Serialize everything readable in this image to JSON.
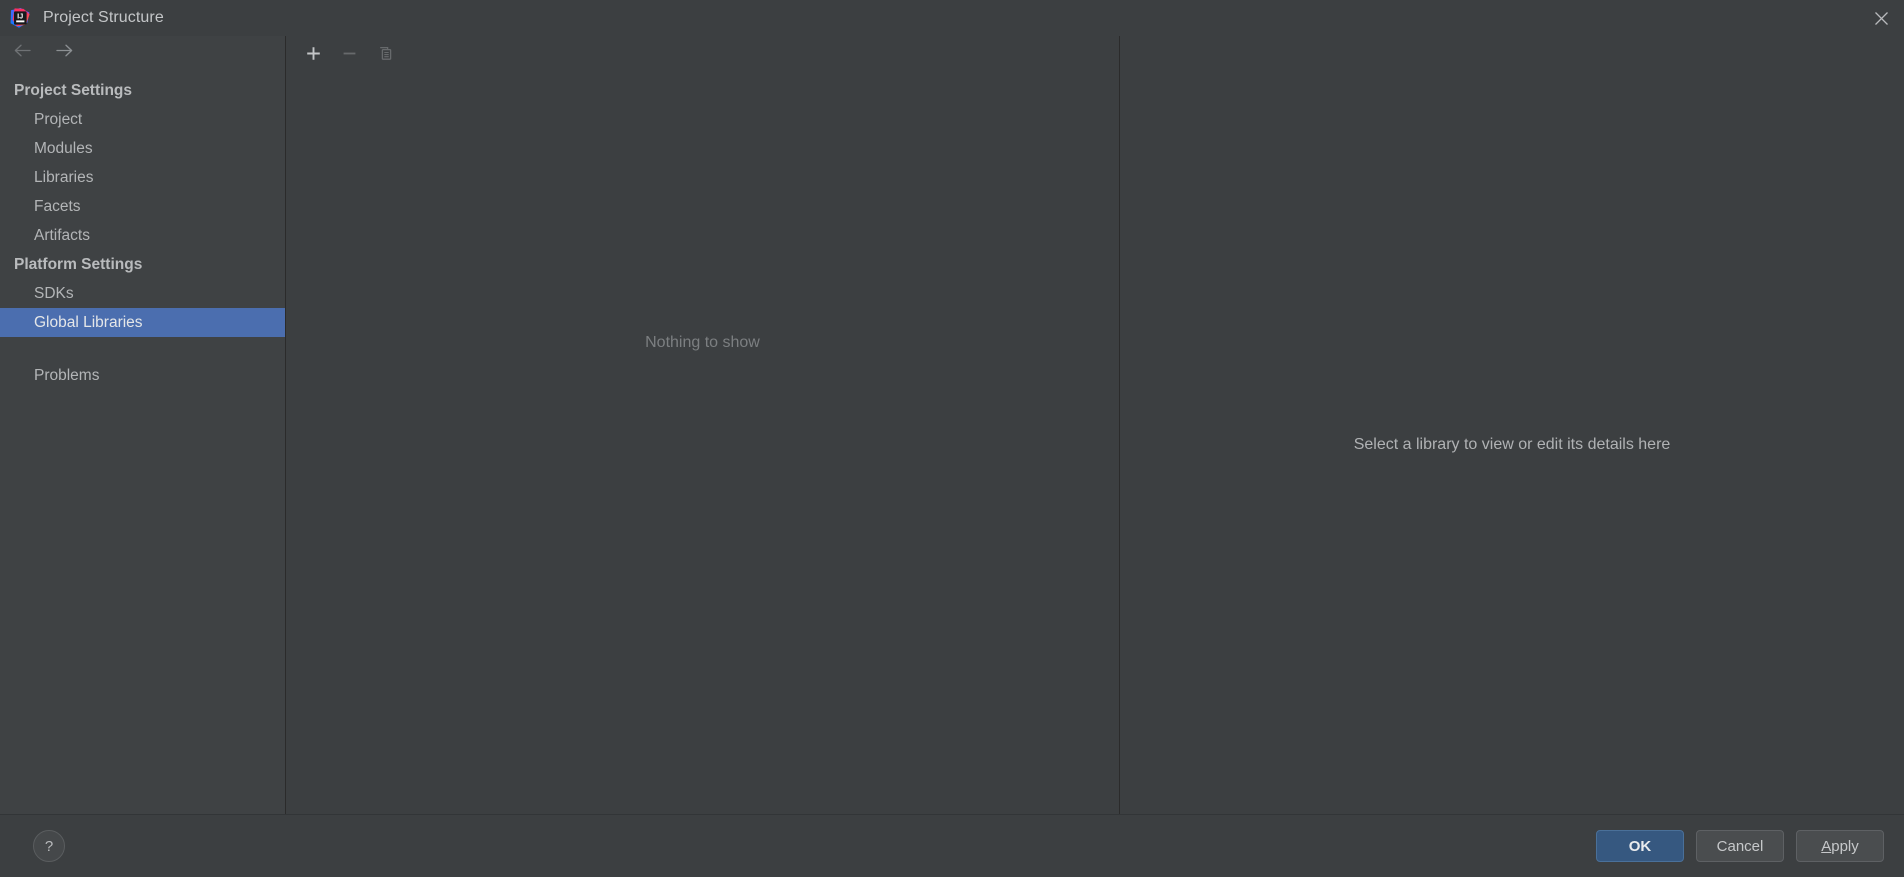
{
  "window": {
    "title": "Project Structure",
    "app_icon": "intellij-idea-logo",
    "close_label": "✕"
  },
  "sidebar": {
    "nav_back_label": "←",
    "nav_forward_label": "→",
    "groups": [
      {
        "header": "Project Settings",
        "items": [
          {
            "label": "Project",
            "selected": false
          },
          {
            "label": "Modules",
            "selected": false
          },
          {
            "label": "Libraries",
            "selected": false
          },
          {
            "label": "Facets",
            "selected": false
          },
          {
            "label": "Artifacts",
            "selected": false
          }
        ]
      },
      {
        "header": "Platform Settings",
        "items": [
          {
            "label": "SDKs",
            "selected": false
          },
          {
            "label": "Global Libraries",
            "selected": true
          }
        ]
      }
    ],
    "extra_items": [
      {
        "label": "Problems",
        "selected": false
      }
    ]
  },
  "middle_panel": {
    "toolbar": {
      "add_label": "add-icon",
      "remove_label": "remove-icon",
      "copy_label": "copy-icon"
    },
    "empty_text": "Nothing to show"
  },
  "right_panel": {
    "placeholder_text": "Select a library to view or edit its details here"
  },
  "footer": {
    "help_label": "?",
    "ok_label": "OK",
    "cancel_label": "Cancel",
    "apply_mnemonic": "A",
    "apply_rest": "pply"
  },
  "colors": {
    "background": "#3c3f41",
    "sidebar_background": "#3f4244",
    "selection": "#4b6eaf",
    "primary_button": "#365880",
    "divider": "#2b2b2b",
    "text": "#b3b5b7",
    "muted_text": "#7c7f81"
  }
}
